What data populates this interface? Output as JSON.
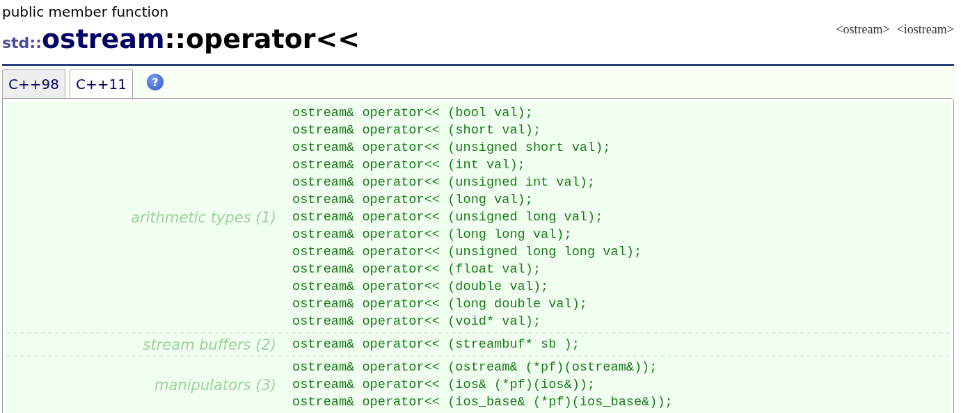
{
  "header": {
    "kind_label": "public member function",
    "title": {
      "namespace": "std::",
      "class": "ostream",
      "member": "::operator<<"
    },
    "headers": [
      "<ostream>",
      "<iostream>"
    ]
  },
  "tabs": [
    {
      "label": "C++98",
      "selected": false
    },
    {
      "label": "C++11",
      "selected": true
    }
  ],
  "help": "?",
  "sections": [
    {
      "label": "arithmetic types (1)",
      "lines": [
        "ostream& operator<< (bool val);",
        "ostream& operator<< (short val);",
        "ostream& operator<< (unsigned short val);",
        "ostream& operator<< (int val);",
        "ostream& operator<< (unsigned int val);",
        "ostream& operator<< (long val);",
        "ostream& operator<< (unsigned long val);",
        "ostream& operator<< (long long val);",
        "ostream& operator<< (unsigned long long val);",
        "ostream& operator<< (float val);",
        "ostream& operator<< (double val);",
        "ostream& operator<< (long double val);",
        "ostream& operator<< (void* val);"
      ]
    },
    {
      "label": "stream buffers (2)",
      "lines": [
        "ostream& operator<< (streambuf* sb );"
      ]
    },
    {
      "label": "manipulators (3)",
      "lines": [
        "ostream& operator<< (ostream& (*pf)(ostream&));",
        "ostream& operator<< (ios& (*pf)(ios&));",
        "ostream& operator<< (ios_base& (*pf)(ios_base&));"
      ]
    }
  ]
}
